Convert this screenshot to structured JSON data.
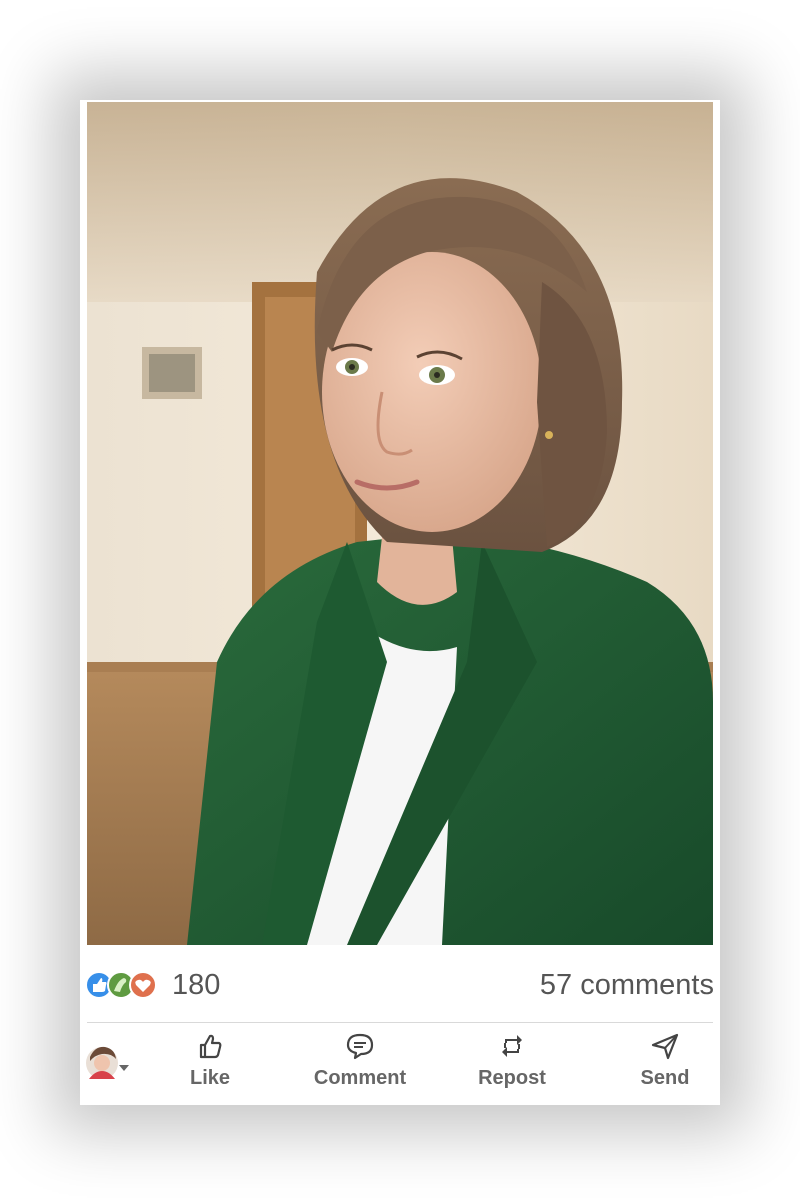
{
  "post": {
    "photo": {
      "description_icon": "portrait-photo"
    },
    "reactions": {
      "icons": [
        "like-reaction-icon",
        "celebrate-reaction-icon",
        "love-reaction-icon"
      ],
      "count": "180"
    },
    "comments": {
      "label": "57 comments"
    },
    "actions": [
      {
        "label": "Like",
        "icon": "thumbs-up-icon"
      },
      {
        "label": "Comment",
        "icon": "comment-icon"
      },
      {
        "label": "Repost",
        "icon": "repost-icon"
      },
      {
        "label": "Send",
        "icon": "send-icon"
      }
    ]
  },
  "colors": {
    "like_blue": "#378fe9",
    "celebrate_green": "#5f9b41",
    "love_red": "#df704d",
    "jacket_green": "#1f5a32",
    "text_gray": "#666666"
  }
}
